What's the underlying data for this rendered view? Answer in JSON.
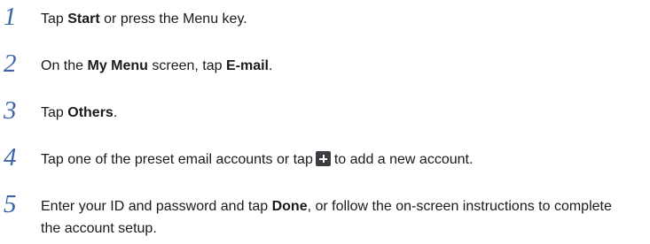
{
  "steps": [
    {
      "number": "1",
      "parts": [
        "Tap ",
        "Start",
        " or press the Menu key."
      ]
    },
    {
      "number": "2",
      "parts": [
        "On the ",
        "My Menu",
        " screen, tap ",
        "E-mail",
        "."
      ]
    },
    {
      "number": "3",
      "parts": [
        "Tap ",
        "Others",
        "."
      ]
    },
    {
      "number": "4",
      "parts": [
        "Tap one of the preset email accounts or tap",
        "to add a new account."
      ],
      "icon": "add-icon"
    },
    {
      "number": "5",
      "parts": [
        "Enter your ID and password and tap ",
        "Done",
        ", or follow the on-screen instructions to complete the account setup."
      ]
    }
  ]
}
